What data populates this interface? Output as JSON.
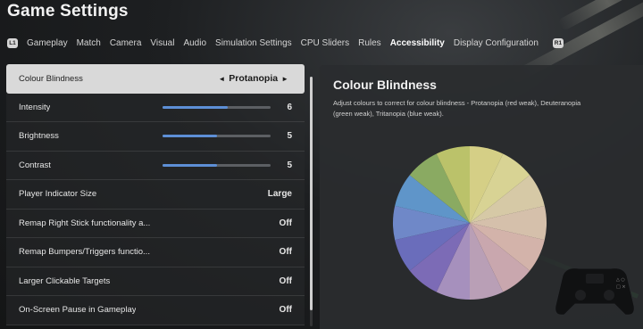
{
  "header": {
    "title": "Game Settings"
  },
  "tabs": {
    "left_bumper": "L1",
    "right_bumper": "R1",
    "items": [
      {
        "label": "Gameplay"
      },
      {
        "label": "Match"
      },
      {
        "label": "Camera"
      },
      {
        "label": "Visual"
      },
      {
        "label": "Audio"
      },
      {
        "label": "Simulation Settings"
      },
      {
        "label": "CPU Sliders"
      },
      {
        "label": "Rules"
      },
      {
        "label": "Accessibility",
        "active": true
      },
      {
        "label": "Display Configuration"
      }
    ]
  },
  "settings": {
    "colour_blindness": {
      "label": "Colour Blindness",
      "value": "Protanopia",
      "prev_icon": "◄",
      "next_icon": "►"
    },
    "intensity": {
      "label": "Intensity",
      "value": "6",
      "max": 10
    },
    "brightness": {
      "label": "Brightness",
      "value": "5",
      "max": 10
    },
    "contrast": {
      "label": "Contrast",
      "value": "5",
      "max": 10
    },
    "player_indicator": {
      "label": "Player Indicator Size",
      "value": "Large"
    },
    "remap_right_stick": {
      "label": "Remap Right Stick functionality a...",
      "value": "Off"
    },
    "remap_bumpers": {
      "label": "Remap Bumpers/Triggers functio...",
      "value": "Off"
    },
    "larger_targets": {
      "label": "Larger Clickable Targets",
      "value": "Off"
    },
    "onscreen_pause": {
      "label": "On-Screen Pause in Gameplay",
      "value": "Off"
    }
  },
  "preview": {
    "title": "Colour Blindness",
    "description": "Adjust colours to correct for colour blindness - Protanopia (red weak), Deuteranopia (green weak), Tritanopia (blue weak).",
    "wheel_colors": [
      "#d5cf86",
      "#d8d394",
      "#d6c9a6",
      "#d5c0ab",
      "#d3b3aa",
      "#c9a7ae",
      "#b99fb6",
      "#a690bd",
      "#7c6bb6",
      "#6a6dbb",
      "#6f88c8",
      "#5f95c9",
      "#8aaa62",
      "#bbc26a"
    ],
    "accent_color": "#5d8fd6"
  }
}
